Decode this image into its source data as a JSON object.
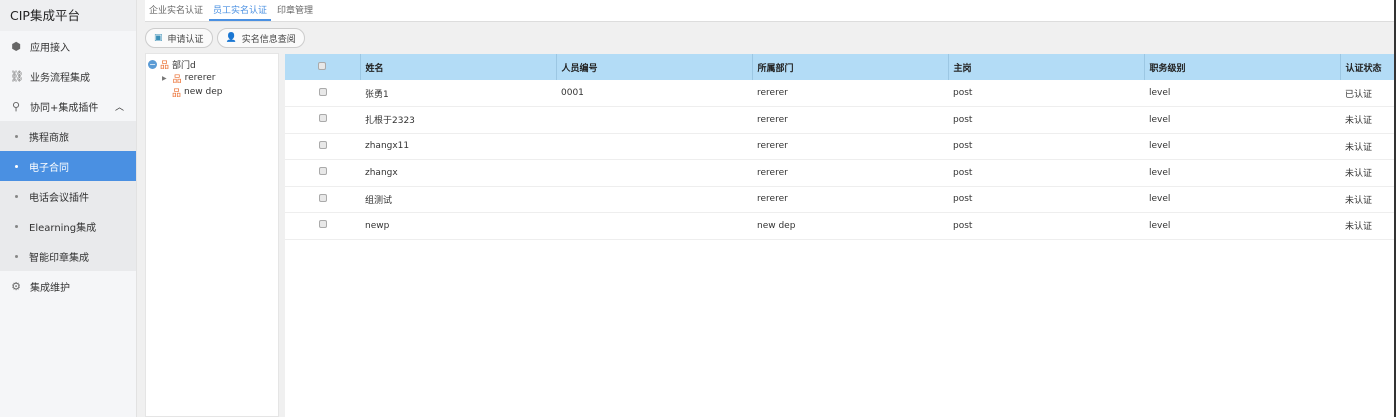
{
  "app": {
    "title": "CIP集成平台"
  },
  "sidebar": {
    "items": [
      {
        "label": "应用接入",
        "icon": "cube-icon"
      },
      {
        "label": "业务流程集成",
        "icon": "flow-icon"
      },
      {
        "label": "协同+集成插件",
        "icon": "share-icon",
        "expanded": true,
        "children": [
          {
            "label": "携程商旅"
          },
          {
            "label": "电子合同",
            "active": true
          },
          {
            "label": "电话会议插件"
          },
          {
            "label": "Elearning集成"
          },
          {
            "label": "智能印章集成"
          }
        ]
      },
      {
        "label": "集成维护",
        "icon": "gear-icon"
      }
    ]
  },
  "tabs": [
    {
      "label": "企业实名认证"
    },
    {
      "label": "员工实名认证",
      "active": true
    },
    {
      "label": "印章管理"
    }
  ],
  "toolbar": {
    "apply": "申请认证",
    "query": "实名信息查阅"
  },
  "tree": {
    "root": "部门d",
    "children": [
      "rererer",
      "new dep"
    ]
  },
  "table": {
    "columns": [
      "姓名",
      "人员编号",
      "所属部门",
      "主岗",
      "职务级别",
      "认证状态"
    ],
    "rows": [
      [
        "张勇1",
        "0001",
        "rererer",
        "post",
        "level",
        "已认证"
      ],
      [
        "扎根于2323",
        "",
        "rererer",
        "post",
        "level",
        "未认证"
      ],
      [
        "zhangx11",
        "",
        "rererer",
        "post",
        "level",
        "未认证"
      ],
      [
        "zhangx",
        "",
        "rererer",
        "post",
        "level",
        "未认证"
      ],
      [
        "组测试",
        "",
        "rererer",
        "post",
        "level",
        "未认证"
      ],
      [
        "newp",
        "",
        "new dep",
        "post",
        "level",
        "未认证"
      ]
    ]
  },
  "colors": {
    "accent": "#4a90e2",
    "header": "#b3dcf6"
  }
}
